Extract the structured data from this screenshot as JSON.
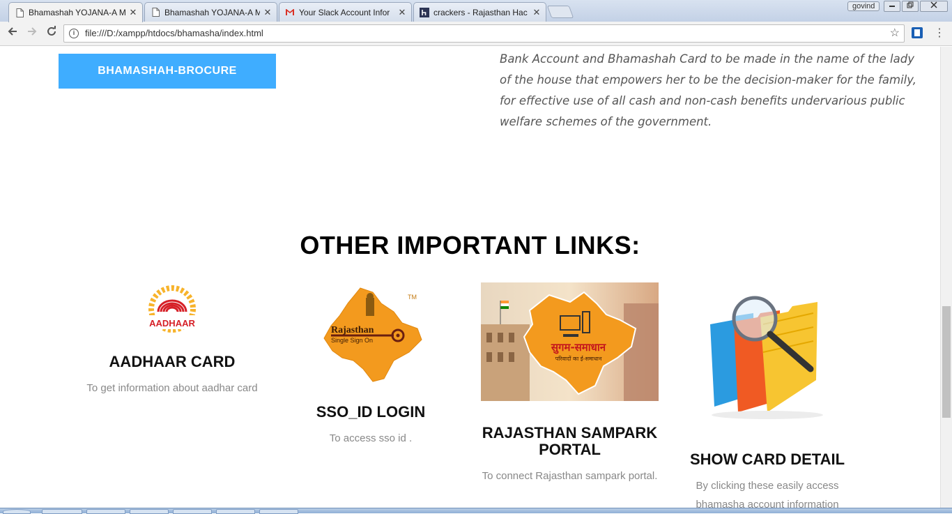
{
  "browser": {
    "tabs": [
      {
        "title": "Bhamashah YOJANA-A M",
        "icon": "document-icon",
        "active": true
      },
      {
        "title": "Bhamashah YOJANA-A M",
        "icon": "document-icon",
        "active": false
      },
      {
        "title": "Your Slack Account Infor",
        "icon": "gmail-icon",
        "active": false
      },
      {
        "title": "crackers - Rajasthan Hac",
        "icon": "hackerearth-icon",
        "active": false
      }
    ],
    "close_glyph": "✕",
    "user_name": "govind",
    "url": "file:///D:/xampp/htdocs/bhamasha/index.html"
  },
  "page": {
    "brocure_button": "BHAMASHAH-BROCURE",
    "intro_text": "Bank Account and Bhamashah Card to be made in the name of the lady of the house that empowers her to be the decision-maker for the family, for effective use of all cash and non-cash benefits undervarious public welfare schemes of the government.",
    "section_title": "OTHER IMPORTANT LINKS:",
    "cards": [
      {
        "title": "AADHAAR CARD",
        "desc": "To get information about aadhar card",
        "logo_text": "AADHAAR"
      },
      {
        "title": "SSO_ID LOGIN",
        "desc": "To access sso id .",
        "logo_text_1": "Rajasthan",
        "logo_text_2": "Single Sign On",
        "tm": "TM"
      },
      {
        "title": "RAJASTHAN SAMPARK PORTAL",
        "desc": "To connect Rajasthan sampark portal.",
        "logo_text_1": "सुगम-समाधान",
        "logo_text_2": "परिवादों का ई-समाधान"
      },
      {
        "title": "SHOW CARD DETAIL",
        "desc": "By clicking these easily access bhamasha account information"
      }
    ]
  },
  "colors": {
    "accent_button": "#3fadff",
    "aadhaar_red": "#d62027",
    "aadhaar_yellow": "#f7b32b",
    "rajasthan_orange": "#f39a1e"
  }
}
